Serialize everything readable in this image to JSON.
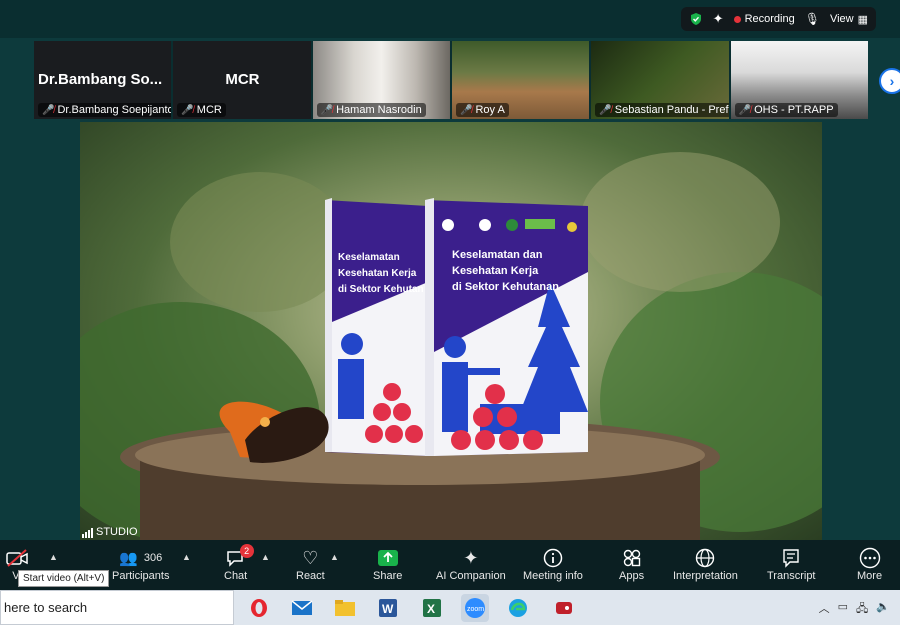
{
  "topbar": {
    "recording_label": "Recording",
    "view_label": "View"
  },
  "participants": [
    {
      "tile_name": "Dr.Bambang  So...",
      "name": "Dr.Bambang Soepijanto"
    },
    {
      "tile_name": "MCR",
      "name": "MCR"
    },
    {
      "name": "Hamam Nasrodin"
    },
    {
      "name": "Roy A"
    },
    {
      "name": "Sebastian Pandu - Pref..."
    },
    {
      "name": "OHS - PT.RAPP"
    }
  ],
  "main_video": {
    "label": "STUDIO",
    "book_title_line1": "Keselamatan dan",
    "book_title_line2": "Kesehatan Kerja",
    "book_title_line3": "di Sektor Kehutanan",
    "book_back_line1": "Keselamatan",
    "book_back_line2": "Kesehatan Kerja",
    "book_back_line3": "di Sektor Kehutan"
  },
  "toolbar": {
    "video_label": "Vi",
    "tooltip": "Start video (Alt+V)",
    "participants_label": "Participants",
    "participants_count": "306",
    "chat_label": "Chat",
    "chat_badge": "2",
    "react_label": "React",
    "share_label": "Share",
    "ai_label": "AI Companion",
    "meeting_info_label": "Meeting info",
    "apps_label": "Apps",
    "interpretation_label": "Interpretation",
    "transcript_label": "Transcript",
    "more_label": "More"
  },
  "taskbar": {
    "search_placeholder": "here to search",
    "apps": [
      "opera-icon",
      "mail-icon",
      "file-explorer-icon",
      "word-icon",
      "excel-icon",
      "zoom-icon",
      "edge-icon",
      "game-icon"
    ]
  },
  "colors": {
    "accent_green": "#19b24b",
    "recording_red": "#e5333a",
    "book_purple": "#3b1f8c",
    "book_blue": "#2346c9"
  }
}
